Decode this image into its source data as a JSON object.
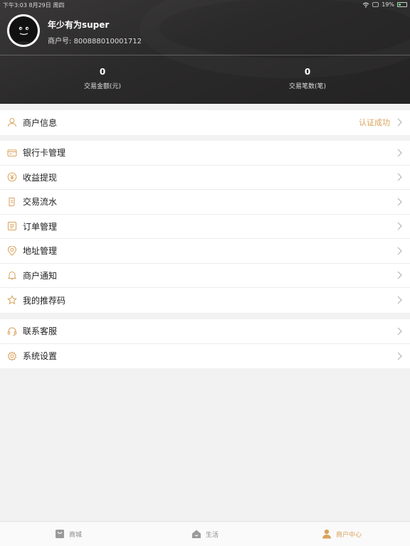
{
  "status_bar": {
    "time_date": "下午3:03   8月29日 周四",
    "battery": "19%"
  },
  "profile": {
    "name": "年少有为super",
    "merchant_label": "商户号:",
    "merchant_no": "800888010001712"
  },
  "stats": [
    {
      "value": "0",
      "label": "交易金额(元)"
    },
    {
      "value": "0",
      "label": "交易笔数(笔)"
    }
  ],
  "menu_groups": [
    [
      {
        "label": "商户信息",
        "extra": "认证成功",
        "icon": "user-icon"
      }
    ],
    [
      {
        "label": "银行卡管理",
        "icon": "bank-card-icon"
      },
      {
        "label": "收益提现",
        "icon": "yuan-coin-icon"
      },
      {
        "label": "交易流水",
        "icon": "receipt-icon"
      },
      {
        "label": "订单管理",
        "icon": "order-list-icon"
      },
      {
        "label": "地址管理",
        "icon": "location-pin-icon"
      },
      {
        "label": "商户通知",
        "icon": "bell-icon"
      },
      {
        "label": "我的推荐码",
        "icon": "star-icon"
      }
    ],
    [
      {
        "label": "联系客服",
        "icon": "headset-icon"
      },
      {
        "label": "系统设置",
        "icon": "gear-icon"
      }
    ]
  ],
  "tabs": [
    {
      "label": "商城",
      "icon": "shop-bag-icon",
      "active": false
    },
    {
      "label": "生活",
      "icon": "home-icon",
      "active": false
    },
    {
      "label": "商户中心",
      "icon": "person-icon",
      "active": true
    }
  ],
  "colors": {
    "accent": "#d9a25b",
    "header_bg": "#2b2a2a",
    "page_bg": "#f2f2f2"
  }
}
